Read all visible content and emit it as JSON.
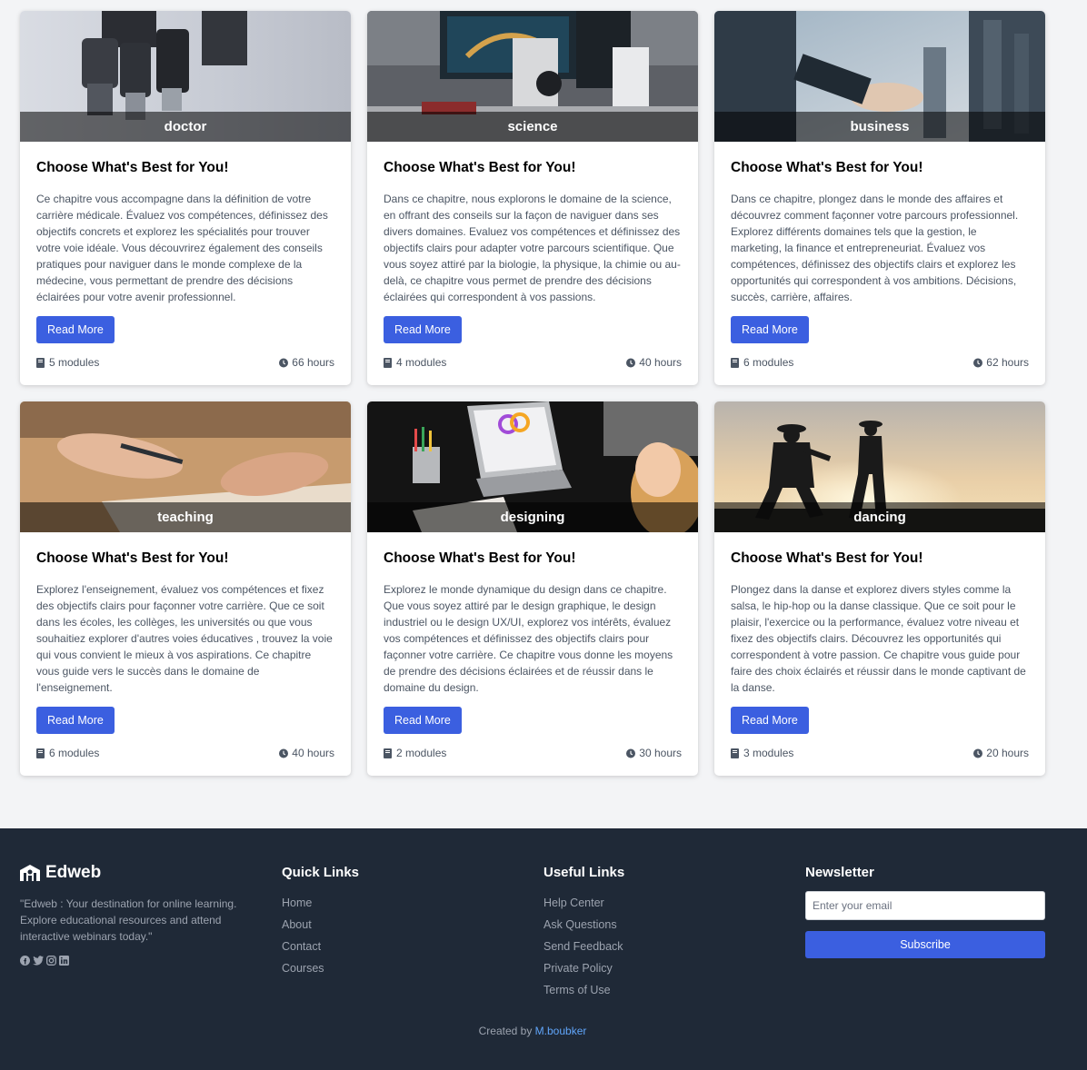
{
  "courses": [
    {
      "category": "doctor",
      "title": "Choose What's Best for You!",
      "description": "Ce chapitre vous accompagne dans la définition de votre carrière médicale. Évaluez vos compétences, définissez des objectifs concrets et explorez les spécialités pour trouver votre voie idéale. Vous découvrirez également des conseils pratiques pour naviguer dans le monde complexe de la médecine, vous permettant de prendre des décisions éclairées pour votre avenir professionnel.",
      "button": "Read More",
      "modules": "5 modules",
      "hours": "66 hours"
    },
    {
      "category": "science",
      "title": "Choose What's Best for You!",
      "description": "Dans ce chapitre, nous explorons le domaine de la science, en offrant des conseils sur la façon de naviguer dans ses divers domaines. Evaluez vos compétences et définissez des objectifs clairs pour adapter votre parcours scientifique. Que vous soyez attiré par la biologie, la physique, la chimie ou au-delà, ce chapitre vous permet de prendre des décisions éclairées qui correspondent à vos passions.",
      "button": "Read More",
      "modules": "4 modules",
      "hours": "40 hours"
    },
    {
      "category": "business",
      "title": "Choose What's Best for You!",
      "description": "Dans ce chapitre, plongez dans le monde des affaires et découvrez comment façonner votre parcours professionnel. Explorez différents domaines tels que la gestion, le marketing, la finance et entrepreneuriat. Évaluez vos compétences, définissez des objectifs clairs et explorez les opportunités qui correspondent à vos ambitions. Décisions, succès, carrière, affaires.",
      "button": "Read More",
      "modules": "6 modules",
      "hours": "62 hours"
    },
    {
      "category": "teaching",
      "title": "Choose What's Best for You!",
      "description": "Explorez l'enseignement, évaluez vos compétences et fixez des objectifs clairs pour façonner votre carrière. Que ce soit dans les écoles, les collèges, les universités ou que vous souhaitiez explorer d'autres voies éducatives , trouvez la voie qui vous convient le mieux à vos aspirations. Ce chapitre vous guide vers le succès dans le domaine de l'enseignement.",
      "button": "Read More",
      "modules": "6 modules",
      "hours": "40 hours"
    },
    {
      "category": "designing",
      "title": "Choose What's Best for You!",
      "description": "Explorez le monde dynamique du design dans ce chapitre. Que vous soyez attiré par le design graphique, le design industriel ou le design UX/UI, explorez vos intérêts, évaluez vos compétences et définissez des objectifs clairs pour façonner votre carrière. Ce chapitre vous donne les moyens de prendre des décisions éclairées et de réussir dans le domaine du design.",
      "button": "Read More",
      "modules": "2 modules",
      "hours": "30 hours"
    },
    {
      "category": "dancing",
      "title": "Choose What's Best for You!",
      "description": "Plongez dans la danse et explorez divers styles comme la salsa, le hip-hop ou la danse classique. Que ce soit pour le plaisir, l'exercice ou la performance, évaluez votre niveau et fixez des objectifs clairs. Découvrez les opportunités qui correspondent à votre passion. Ce chapitre vous guide pour faire des choix éclairés et réussir dans le monde captivant de la danse.",
      "button": "Read More",
      "modules": "3 modules",
      "hours": "20 hours"
    }
  ],
  "footer": {
    "brand": "Edweb",
    "tagline": "\"Edweb : Your destination for online learning. Explore educational resources and attend interactive webinars today.\"",
    "quick_links": {
      "heading": "Quick Links",
      "items": [
        "Home",
        "About",
        "Contact",
        "Courses"
      ]
    },
    "useful_links": {
      "heading": "Useful Links",
      "items": [
        "Help Center",
        "Ask Questions",
        "Send Feedback",
        "Private Policy",
        "Terms of Use"
      ]
    },
    "newsletter": {
      "heading": "Newsletter",
      "placeholder": "Enter your email",
      "button": "Subscribe"
    },
    "credit_prefix": "Created by",
    "credit_author": "M.boubker",
    "icons": [
      "facebook-icon",
      "twitter-icon",
      "instagram-icon",
      "linkedin-icon"
    ]
  },
  "colors": {
    "accent": "#3b5fe0",
    "footer_bg": "#1f2937",
    "page_bg": "#f3f4f6",
    "link": "#60a5fa"
  }
}
